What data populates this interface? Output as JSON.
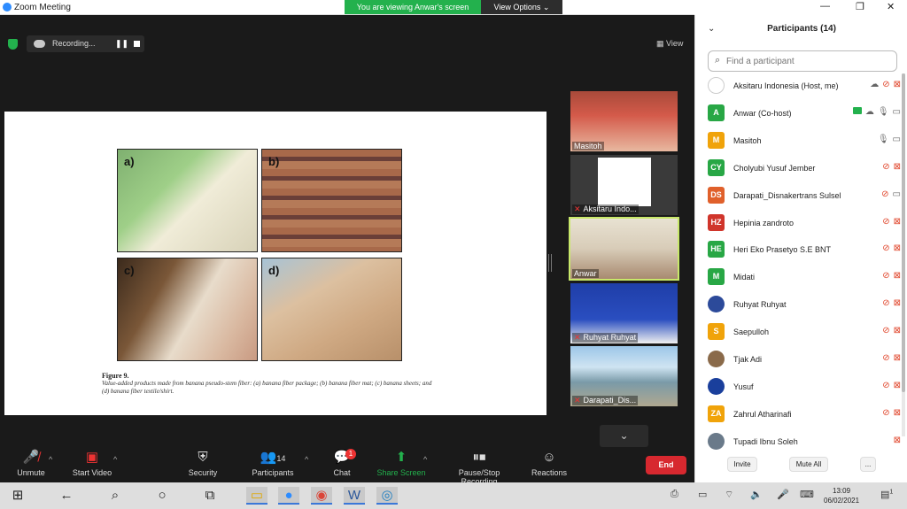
{
  "app": {
    "title": "Zoom Meeting"
  },
  "banner": {
    "viewing": "You are viewing Anwar's screen",
    "view_options": "View Options ⌄"
  },
  "window_controls": {
    "minimize": "—",
    "maximize": "❐",
    "close": "✕"
  },
  "recording": {
    "label": "Recording...",
    "pause": "❚❚"
  },
  "view_button": "▦ View",
  "shared_doc": {
    "panels": [
      {
        "label": "a)"
      },
      {
        "label": "b)"
      },
      {
        "label": "c)"
      },
      {
        "label": "d)"
      }
    ],
    "figure_title": "Figure 9.",
    "figure_caption": "Value-added products made from banana pseudo-stem fiber: (a) banana fiber package; (b) banana fiber mat; (c) banana sheets; and (d) banana fiber textile/shirt."
  },
  "video_thumbnails": [
    {
      "name": "Masitoh",
      "muted": false
    },
    {
      "name": "Aksitaru Indo...",
      "muted": true
    },
    {
      "name": "Anwar",
      "muted": false,
      "active": true
    },
    {
      "name": "Ruhyat Ruhyat",
      "muted": true
    },
    {
      "name": "Darapati_Dis...",
      "muted": true
    }
  ],
  "scroll_down_icon": "chevron-down",
  "toolbar": {
    "unmute": "Unmute",
    "start_video": "Start Video",
    "security": "Security",
    "participants": "Participants",
    "participants_count": "14",
    "chat": "Chat",
    "chat_badge": "1",
    "share_screen": "Share Screen",
    "pause_stop": "Pause/Stop Recording",
    "reactions": "Reactions",
    "end": "End"
  },
  "panel": {
    "title": "Participants (14)",
    "search_placeholder": "Find a participant",
    "invite": "Invite",
    "mute_all": "Mute All",
    "more": "..."
  },
  "participants": [
    {
      "initials": "",
      "name": "Aksitaru Indonesia (Host, me)",
      "color": "#ffffff",
      "mic_muted": true,
      "video_off": true,
      "recording": true,
      "photo": true
    },
    {
      "initials": "A",
      "name": "Anwar (Co-host)",
      "color": "#28a745",
      "mic_muted": false,
      "video_off": false,
      "sharing": true,
      "recording": true
    },
    {
      "initials": "M",
      "name": "Masitoh",
      "color": "#f0a30a",
      "mic_muted": false,
      "video_off": false
    },
    {
      "initials": "CY",
      "name": "Cholyubi Yusuf Jember",
      "color": "#28a745",
      "mic_muted": true,
      "video_off": true
    },
    {
      "initials": "DS",
      "name": "Darapati_Disnakertrans Sulsel",
      "color": "#e0602b",
      "mic_muted": true,
      "video_off": false
    },
    {
      "initials": "HZ",
      "name": "Hepinia zandroto",
      "color": "#d0352b",
      "mic_muted": true,
      "video_off": true
    },
    {
      "initials": "HE",
      "name": "Heri Eko Prasetyo S.E BNT",
      "color": "#28a745",
      "mic_muted": true,
      "video_off": true
    },
    {
      "initials": "M",
      "name": "Midati",
      "color": "#28a745",
      "mic_muted": true,
      "video_off": true
    },
    {
      "initials": "",
      "name": "Ruhyat Ruhyat",
      "color": "#2c4a9a",
      "mic_muted": true,
      "video_off": true,
      "photo": true
    },
    {
      "initials": "S",
      "name": "Saepulloh",
      "color": "#f0a30a",
      "mic_muted": true,
      "video_off": true
    },
    {
      "initials": "",
      "name": "Tjak Adi",
      "color": "#8a6a4a",
      "mic_muted": true,
      "video_off": true,
      "photo": true
    },
    {
      "initials": "",
      "name": "Yusuf",
      "color": "#1a3f9c",
      "mic_muted": true,
      "video_off": true,
      "photo": true
    },
    {
      "initials": "ZA",
      "name": "Zahrul Atharinafi",
      "color": "#f0a30a",
      "mic_muted": true,
      "video_off": true
    },
    {
      "initials": "",
      "name": "Tupadi Ibnu Soleh",
      "color": "#6a7a8a",
      "mic_muted": false,
      "video_off": true,
      "photo": true
    }
  ],
  "taskbar": {
    "time": "13:09",
    "date": "06/02/2021",
    "notifications": "1"
  }
}
